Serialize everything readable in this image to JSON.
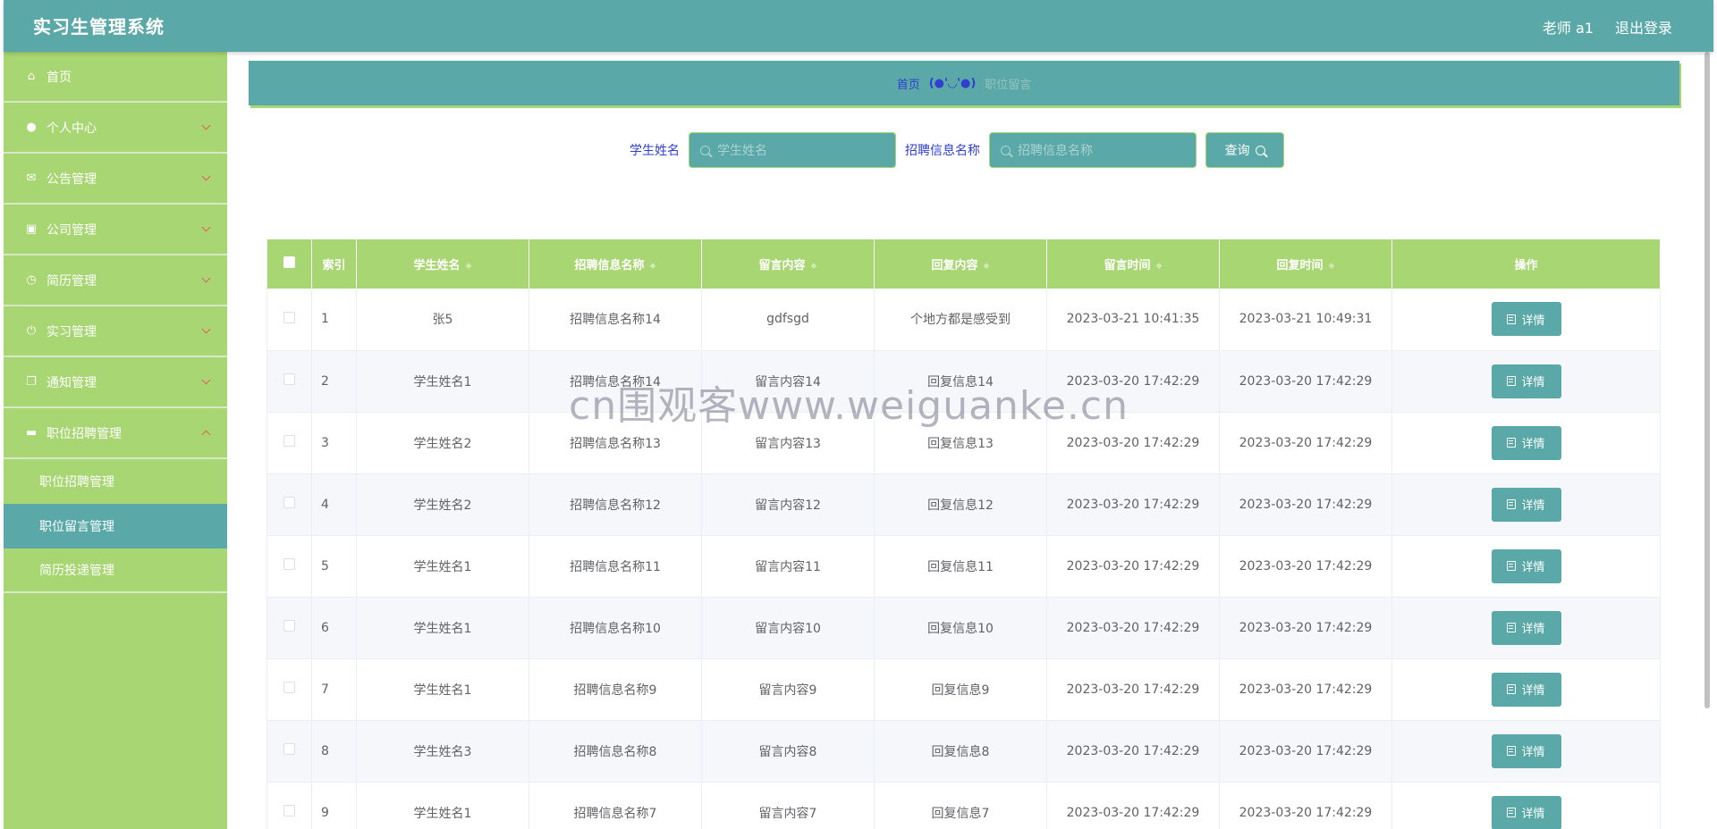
{
  "header": {
    "title": "实习生管理系统",
    "user": "老师 a1",
    "logout": "退出登录"
  },
  "sidebar": {
    "items": [
      {
        "label": "首页",
        "icon": "home-icon",
        "glyph": "⌂"
      },
      {
        "label": "个人中心",
        "icon": "user-icon",
        "glyph": "●"
      },
      {
        "label": "公告管理",
        "icon": "mail-icon",
        "glyph": "✉"
      },
      {
        "label": "公司管理",
        "icon": "chart-icon",
        "glyph": "▣"
      },
      {
        "label": "简历管理",
        "icon": "clock-icon",
        "glyph": "◷"
      },
      {
        "label": "实习管理",
        "icon": "power-icon",
        "glyph": "⏻"
      },
      {
        "label": "通知管理",
        "icon": "copy-icon",
        "glyph": "❐"
      },
      {
        "label": "职位招聘管理",
        "icon": "chat-icon",
        "glyph": "▬"
      }
    ],
    "submenu": [
      {
        "label": "职位招聘管理"
      },
      {
        "label": "职位留言管理"
      },
      {
        "label": "简历投递管理"
      }
    ]
  },
  "breadcrumb": {
    "home": "首页",
    "separator": "(●'◡'●)",
    "current": "职位留言"
  },
  "search": {
    "student_label": "学生姓名",
    "student_placeholder": "学生姓名",
    "job_label": "招聘信息名称",
    "job_placeholder": "招聘信息名称",
    "query_button": "查询"
  },
  "table": {
    "headers": [
      "索引",
      "学生姓名",
      "招聘信息名称",
      "留言内容",
      "回复内容",
      "留言时间",
      "回复时间",
      "操作"
    ],
    "detail_label": "详情",
    "rows": [
      {
        "idx": "1",
        "student": "张5",
        "job": "招聘信息名称14",
        "message": "gdfsgd",
        "reply": "个地方都是感受到",
        "msg_time": "2023-03-21 10:41:35",
        "reply_time": "2023-03-21 10:49:31"
      },
      {
        "idx": "2",
        "student": "学生姓名1",
        "job": "招聘信息名称14",
        "message": "留言内容14",
        "reply": "回复信息14",
        "msg_time": "2023-03-20 17:42:29",
        "reply_time": "2023-03-20 17:42:29"
      },
      {
        "idx": "3",
        "student": "学生姓名2",
        "job": "招聘信息名称13",
        "message": "留言内容13",
        "reply": "回复信息13",
        "msg_time": "2023-03-20 17:42:29",
        "reply_time": "2023-03-20 17:42:29"
      },
      {
        "idx": "4",
        "student": "学生姓名2",
        "job": "招聘信息名称12",
        "message": "留言内容12",
        "reply": "回复信息12",
        "msg_time": "2023-03-20 17:42:29",
        "reply_time": "2023-03-20 17:42:29"
      },
      {
        "idx": "5",
        "student": "学生姓名1",
        "job": "招聘信息名称11",
        "message": "留言内容11",
        "reply": "回复信息11",
        "msg_time": "2023-03-20 17:42:29",
        "reply_time": "2023-03-20 17:42:29"
      },
      {
        "idx": "6",
        "student": "学生姓名1",
        "job": "招聘信息名称10",
        "message": "留言内容10",
        "reply": "回复信息10",
        "msg_time": "2023-03-20 17:42:29",
        "reply_time": "2023-03-20 17:42:29"
      },
      {
        "idx": "7",
        "student": "学生姓名1",
        "job": "招聘信息名称9",
        "message": "留言内容9",
        "reply": "回复信息9",
        "msg_time": "2023-03-20 17:42:29",
        "reply_time": "2023-03-20 17:42:29"
      },
      {
        "idx": "8",
        "student": "学生姓名3",
        "job": "招聘信息名称8",
        "message": "留言内容8",
        "reply": "回复信息8",
        "msg_time": "2023-03-20 17:42:29",
        "reply_time": "2023-03-20 17:42:29"
      },
      {
        "idx": "9",
        "student": "学生姓名1",
        "job": "招聘信息名称7",
        "message": "留言内容7",
        "reply": "回复信息7",
        "msg_time": "2023-03-20 17:42:29",
        "reply_time": "2023-03-20 17:42:29"
      }
    ]
  },
  "watermark": "cn围观客www.weiguanke.cn",
  "colors": {
    "primary": "#5aa8a8",
    "accent": "#a8d672",
    "link": "#2f3fd0"
  }
}
